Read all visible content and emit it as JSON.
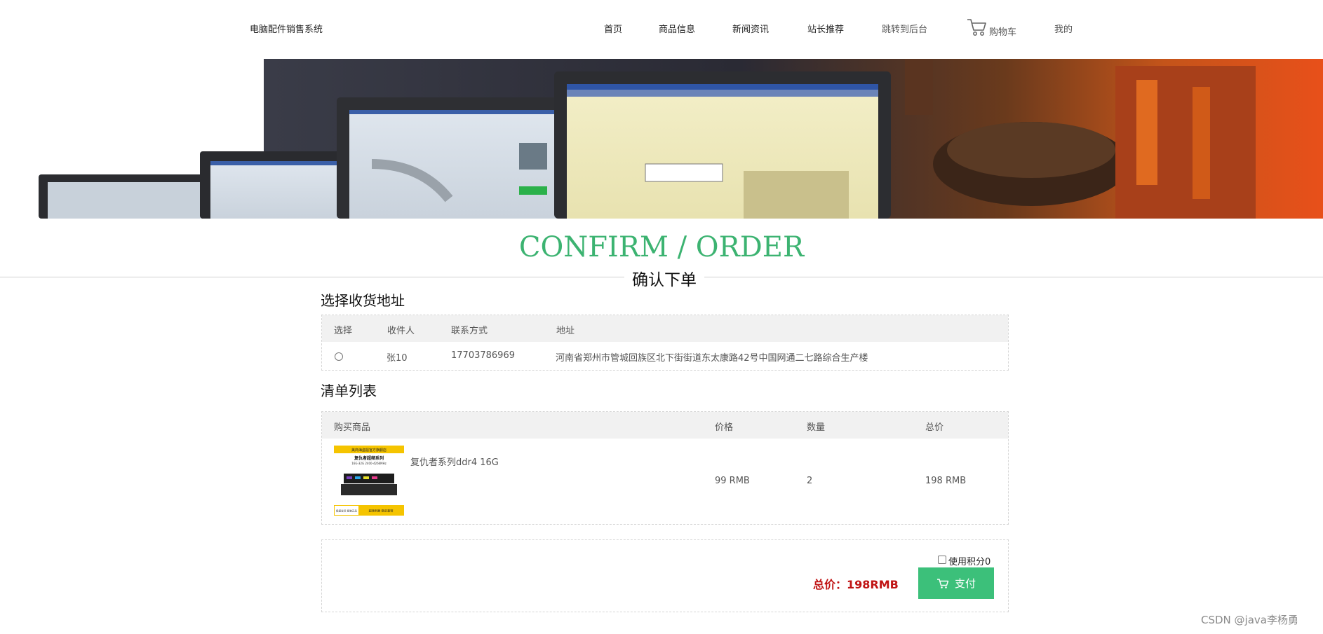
{
  "header": {
    "brand": "电脑配件销售系统",
    "nav": {
      "home": "首页",
      "products": "商品信息",
      "news": "新闻资讯",
      "recommend": "站长推荐",
      "admin": "跳转到后台",
      "cart": "购物车",
      "mine": "我的"
    }
  },
  "banner": {
    "alt": "banner"
  },
  "heading": {
    "english": "CONFIRM / ORDER",
    "chinese": "确认下单"
  },
  "address_section": {
    "title": "选择收货地址",
    "columns": [
      "选择",
      "收件人",
      "联系方式",
      "地址"
    ],
    "rows": [
      {
        "recipient": "张10",
        "phone": "17703786969",
        "address": "河南省郑州市管城回族区北下街街道东太康路42号中国网通二七路综合生产楼",
        "selected": false
      }
    ]
  },
  "items_section": {
    "title": "清单列表",
    "columns": [
      "购买商品",
      "价格",
      "数量",
      "总价"
    ],
    "rows": [
      {
        "name": "复仇者系列ddr4 16G",
        "price": "99 RMB",
        "quantity": "2",
        "total": "198 RMB"
      }
    ],
    "product_image_text": {
      "banner": "美商海盗船官方旗舰店",
      "series": "复仇者超频系列",
      "spec": "16G-32G 2400-4266MHz",
      "tag_left": "极速发货 原装正品",
      "tag_right": "超频利器 稳定兼容"
    }
  },
  "payment": {
    "points_label": "使用积分0",
    "total_label": "总价：198RMB",
    "pay_button": "支付"
  },
  "watermark": "CSDN @java李杨勇",
  "colors": {
    "accent": "#3cb371",
    "price": "#c01414",
    "pay_button": "#3cc07a"
  }
}
